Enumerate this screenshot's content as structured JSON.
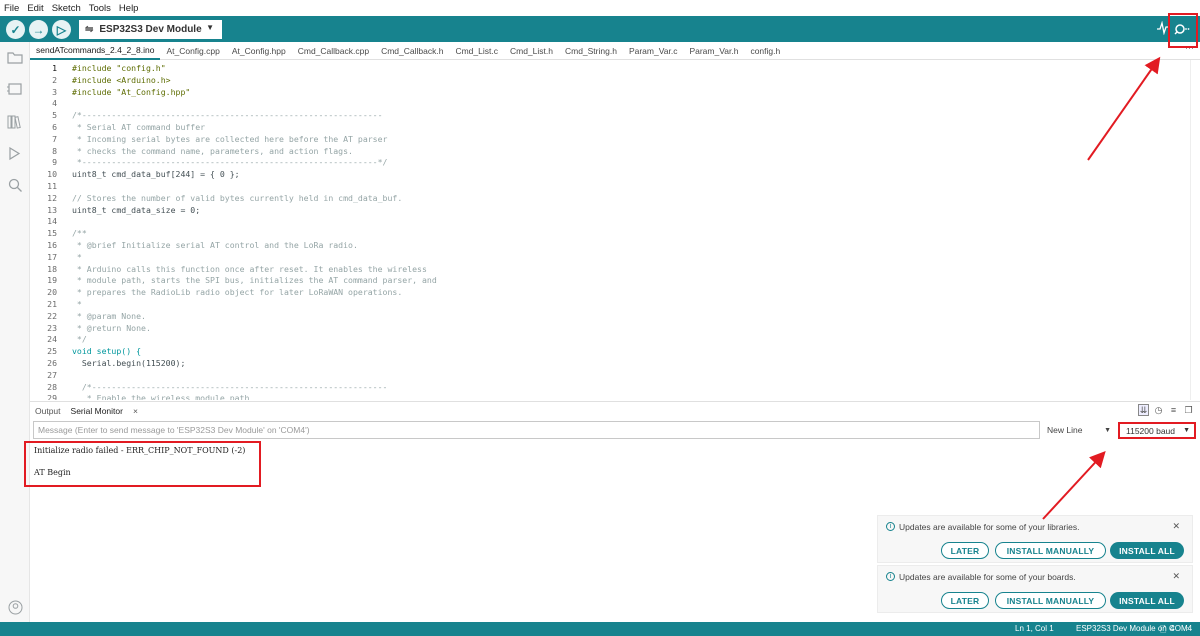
{
  "menu": [
    "File",
    "Edit",
    "Sketch",
    "Tools",
    "Help"
  ],
  "toolbar": {
    "verify_icon": "check-icon",
    "upload_icon": "arrow-right-icon",
    "debug_icon": "debug-icon",
    "board": "ESP32S3 Dev Module",
    "plotter_icon": "serial-plotter-icon",
    "monitor_icon": "serial-monitor-icon"
  },
  "tabs": [
    "sendATcommands_2.4_2_8.ino",
    "At_Config.cpp",
    "At_Config.hpp",
    "Cmd_Callback.cpp",
    "Cmd_Callback.h",
    "Cmd_List.c",
    "Cmd_List.h",
    "Cmd_String.h",
    "Param_Var.c",
    "Param_Var.h",
    "config.h"
  ],
  "tabs_more": "···",
  "code": [
    {
      "n": "1",
      "t": "#include \"config.h\"",
      "c": "pp"
    },
    {
      "n": "2",
      "t": "#include <Arduino.h>",
      "c": "pp"
    },
    {
      "n": "3",
      "t": "#include \"At_Config.hpp\"",
      "c": "pp"
    },
    {
      "n": "4",
      "t": "",
      "c": ""
    },
    {
      "n": "5",
      "t": "/*-------------------------------------------------------------",
      "c": "comment"
    },
    {
      "n": "6",
      "t": " * Serial AT command buffer",
      "c": "comment"
    },
    {
      "n": "7",
      "t": " * Incoming serial bytes are collected here before the AT parser",
      "c": "comment"
    },
    {
      "n": "8",
      "t": " * checks the command name, parameters, and action flags.",
      "c": "comment"
    },
    {
      "n": "9",
      "t": " *------------------------------------------------------------*/",
      "c": "comment"
    },
    {
      "n": "10",
      "t": "uint8_t cmd_data_buf[244] = { 0 };",
      "c": ""
    },
    {
      "n": "11",
      "t": "",
      "c": ""
    },
    {
      "n": "12",
      "t": "// Stores the number of valid bytes currently held in cmd_data_buf.",
      "c": "comment"
    },
    {
      "n": "13",
      "t": "uint8_t cmd_data_size = 0;",
      "c": ""
    },
    {
      "n": "14",
      "t": "",
      "c": ""
    },
    {
      "n": "15",
      "t": "/**",
      "c": "comment"
    },
    {
      "n": "16",
      "t": " * @brief Initialize serial AT control and the LoRa radio.",
      "c": "comment"
    },
    {
      "n": "17",
      "t": " *",
      "c": "comment"
    },
    {
      "n": "18",
      "t": " * Arduino calls this function once after reset. It enables the wireless",
      "c": "comment"
    },
    {
      "n": "19",
      "t": " * module path, starts the SPI bus, initializes the AT command parser, and",
      "c": "comment"
    },
    {
      "n": "20",
      "t": " * prepares the RadioLib radio object for later LoRaWAN operations.",
      "c": "comment"
    },
    {
      "n": "21",
      "t": " *",
      "c": "comment"
    },
    {
      "n": "22",
      "t": " * @param None.",
      "c": "comment"
    },
    {
      "n": "23",
      "t": " * @return None.",
      "c": "comment"
    },
    {
      "n": "24",
      "t": " */",
      "c": "comment"
    },
    {
      "n": "25",
      "t": "void setup() {",
      "c": "kw"
    },
    {
      "n": "26",
      "t": "  Serial.begin(115200);",
      "c": ""
    },
    {
      "n": "27",
      "t": "",
      "c": ""
    },
    {
      "n": "28",
      "t": "  /*------------------------------------------------------------",
      "c": "comment"
    },
    {
      "n": "29",
      "t": "   * Enable the wireless module path",
      "c": "comment"
    }
  ],
  "panel": {
    "tabs": [
      "Output",
      "Serial Monitor"
    ],
    "close_icon": "×",
    "message_placeholder": "Message (Enter to send message to 'ESP32S3 Dev Module' on 'COM4')",
    "line_ending": "New Line",
    "baud": "115200 baud",
    "output_lines": [
      "Initialize radio failed - ERR_CHIP_NOT_FOUND (-2)",
      "",
      "AT Begin"
    ]
  },
  "notifications": [
    {
      "message": "Updates are available for some of your libraries.",
      "later": "LATER",
      "manual": "INSTALL MANUALLY",
      "all": "INSTALL ALL"
    },
    {
      "message": "Updates are available for some of your boards.",
      "later": "LATER",
      "manual": "INSTALL MANUALLY",
      "all": "INSTALL ALL"
    }
  ],
  "statusbar": {
    "position": "Ln 1, Col 1",
    "board": "ESP32S3 Dev Module on COM4",
    "notifications_count": "4"
  },
  "annotation_color": "#e21b22",
  "accent": "#17838e"
}
